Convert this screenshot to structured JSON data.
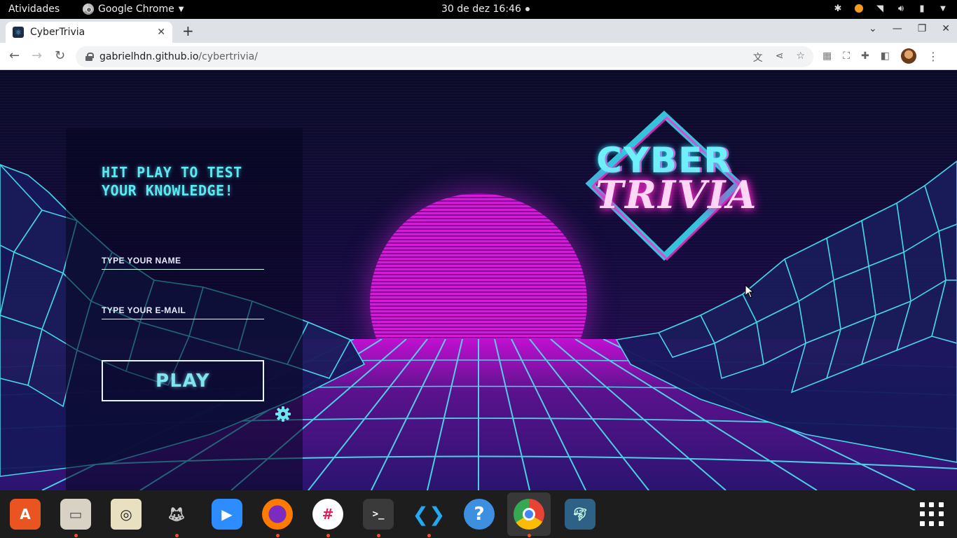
{
  "system_bar": {
    "activities": "Atividades",
    "app_name": "Google Chrome",
    "clock": "30 de dez  16:46"
  },
  "browser": {
    "tab_title": "CyberTrivia",
    "url_host": "gabrielhdn.github.io",
    "url_path": "/cybertrivia/"
  },
  "page": {
    "headline": "HIT PLAY TO TEST YOUR KNOWLEDGE!",
    "name_placeholder": "TYPE YOUR NAME",
    "email_placeholder": "TYPE YOUR E-MAIL",
    "play_label": "PLAY",
    "logo_top": "CYBER",
    "logo_bottom": "TRIVIA"
  },
  "colors": {
    "accent_cyan": "#5fe7f2",
    "accent_magenta": "#d51ad8",
    "status_orange": "#f39c1f"
  },
  "dock": {
    "items": [
      "ubuntu-software-icon",
      "files-icon",
      "rhythmbox-icon",
      "gimp-icon",
      "zoom-icon",
      "firefox-icon",
      "slack-icon",
      "terminal-icon",
      "vscode-icon",
      "help-icon",
      "chrome-icon",
      "mysql-workbench-icon"
    ]
  }
}
